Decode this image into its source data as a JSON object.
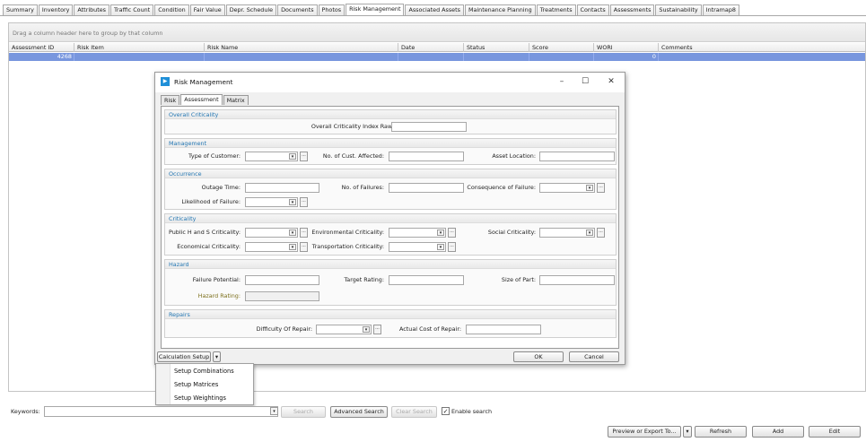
{
  "tabs": [
    "Summary",
    "Inventory",
    "Attributes",
    "Traffic Count",
    "Condition",
    "Fair Value",
    "Depr. Schedule",
    "Documents",
    "Photos",
    "Risk Management",
    "Associated Assets",
    "Maintenance Planning",
    "Treatments",
    "Contacts",
    "Assessments",
    "Sustainability",
    "Intramap8"
  ],
  "active_tab": "Risk Management",
  "grid": {
    "group_hint": "Drag a column header here to group by that column",
    "columns": [
      "Assessment ID",
      "Risk Item",
      "Risk Name",
      "Date",
      "Status",
      "Score",
      "WORI",
      "Comments"
    ],
    "selected_row": {
      "assessment_id": "4268",
      "wori": "0"
    }
  },
  "dialog": {
    "title": "Risk Management",
    "tabs": [
      "Risk",
      "Assessment",
      "Matrix"
    ],
    "active_tab": "Assessment",
    "sections": {
      "overall": {
        "title": "Overall Criticality",
        "index_raw_label": "Overall Criticality Index Raw:"
      },
      "management": {
        "title": "Management",
        "type_of_customer": "Type of Customer:",
        "cust_affected": "No. of Cust. Affected:",
        "asset_location": "Asset Location:"
      },
      "occurrence": {
        "title": "Occurrence",
        "outage_time": "Outage Time:",
        "failures": "No. of Failures:",
        "consequence": "Consequence of Failure:",
        "likelihood": "Likelihood of Failure:"
      },
      "criticality": {
        "title": "Criticality",
        "public_hs": "Public H and S Criticality:",
        "environmental": "Environmental Criticality:",
        "social": "Social Criticality:",
        "economical": "Economical Criticality:",
        "transportation": "Transportation Criticality:"
      },
      "hazard": {
        "title": "Hazard",
        "failure_potential": "Failure Potential:",
        "target_rating": "Target Rating:",
        "size_of_part": "Size of Part:",
        "hazard_rating": "Hazard Rating:"
      },
      "repairs": {
        "title": "Repairs",
        "difficulty": "Difficulty Of Repair:",
        "actual_cost": "Actual Cost of Repair:"
      }
    },
    "buttons": {
      "calc_setup": "Calculation Setup",
      "ok": "OK",
      "cancel": "Cancel"
    }
  },
  "context_menu": [
    "Setup Combinations",
    "Setup Matrices",
    "Setup Weightings"
  ],
  "bottom": {
    "keywords_label": "Keywords:",
    "search": "Search",
    "advanced_search": "Advanced Search",
    "clear_search": "Clear Search",
    "enable_search": "Enable search",
    "preview_export": "Preview or Export To...",
    "refresh": "Refresh",
    "add": "Add",
    "edit": "Edit"
  },
  "colors": {
    "selection": "#7896de",
    "section_header": "#2477b3",
    "hazard_rating_label": "#7c6f1b"
  }
}
